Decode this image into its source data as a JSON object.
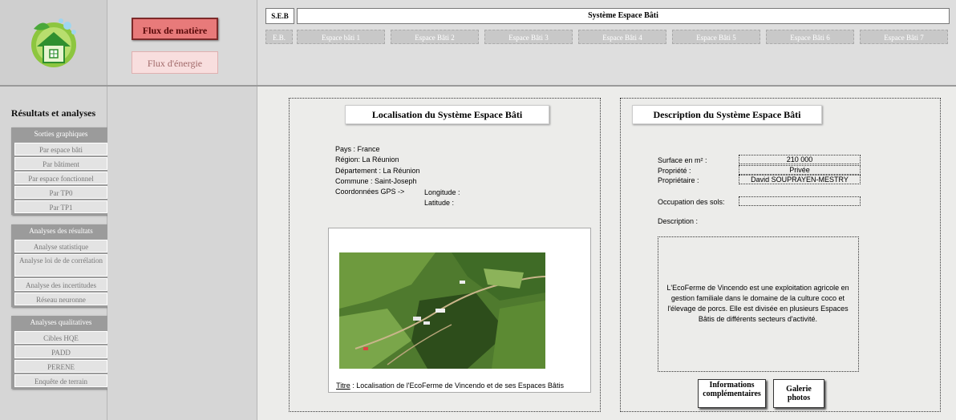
{
  "header": {
    "flux_matiere": "Flux de matière",
    "flux_energie": "Flux d'énergie",
    "seb_label": "S.E.B",
    "seb_title": "Système Espace Bâti",
    "tabs": [
      "E.B.",
      "Espace bâti 1",
      "Espace Bâti 2",
      "Espace Bâti 3",
      "Espace Bâti 4",
      "Espace Bâti 5",
      "Espace Bâti 6",
      "Espace Bâti 7"
    ]
  },
  "sidebar": {
    "title": "Résultats et analyses",
    "groups": [
      {
        "title": "Sorties graphiques",
        "items": [
          "Par espace bâti",
          "Par bâtiment",
          "Par espace fonctionnel",
          "Par TP0",
          "Par TP1"
        ]
      },
      {
        "title": "Analyses des résultats",
        "items": [
          "Analyse statistique",
          "Analyse loi de de corrélation",
          "Analyse des incertitudes",
          "Réseau neuronne"
        ]
      },
      {
        "title": "Analyses qualitatives",
        "items": [
          "Cibles HQE",
          "PADD",
          "PERENE",
          "Enquête de terrain"
        ]
      }
    ]
  },
  "localisation": {
    "title": "Localisation du Système Espace Bâti",
    "pays": "Pays : France",
    "region": "Région: La Réunion",
    "departement": "Département : La Réunion",
    "commune": "Commune : Saint-Joseph",
    "gps": "Coordonnées GPS ->",
    "longitude": "Longitude :",
    "latitude": "Latitude :",
    "caption_prefix": "Titre",
    "caption_text": " : Localisation de l'EcoFerme de Vincendo et de ses Espaces Bâtis"
  },
  "description": {
    "title": "Description du Système  Espace Bâti",
    "surface_label": "Surface en m² :",
    "surface_value": "210 000",
    "propriete_label": "Propriété :",
    "propriete_value": "Privée",
    "proprietaire_label": "Propriétaire :",
    "proprietaire_value": "David SOUPRAYEN-MESTRY",
    "occupation_label": "Occupation des sols:",
    "description_label": "Description :",
    "description_text": "L'EcoFerme de Vincendo est une exploitation agricole en gestion familiale dans le domaine de la culture coco et l'élevage de porcs. Elle est divisée en plusieurs Espaces Bâtis de différents secteurs d'activité.",
    "btn_info": "Informations complémentaires",
    "btn_galerie": "Galerie photos"
  },
  "colors": {
    "accent": "#e87a7a",
    "panel_bg": "#ececea"
  }
}
